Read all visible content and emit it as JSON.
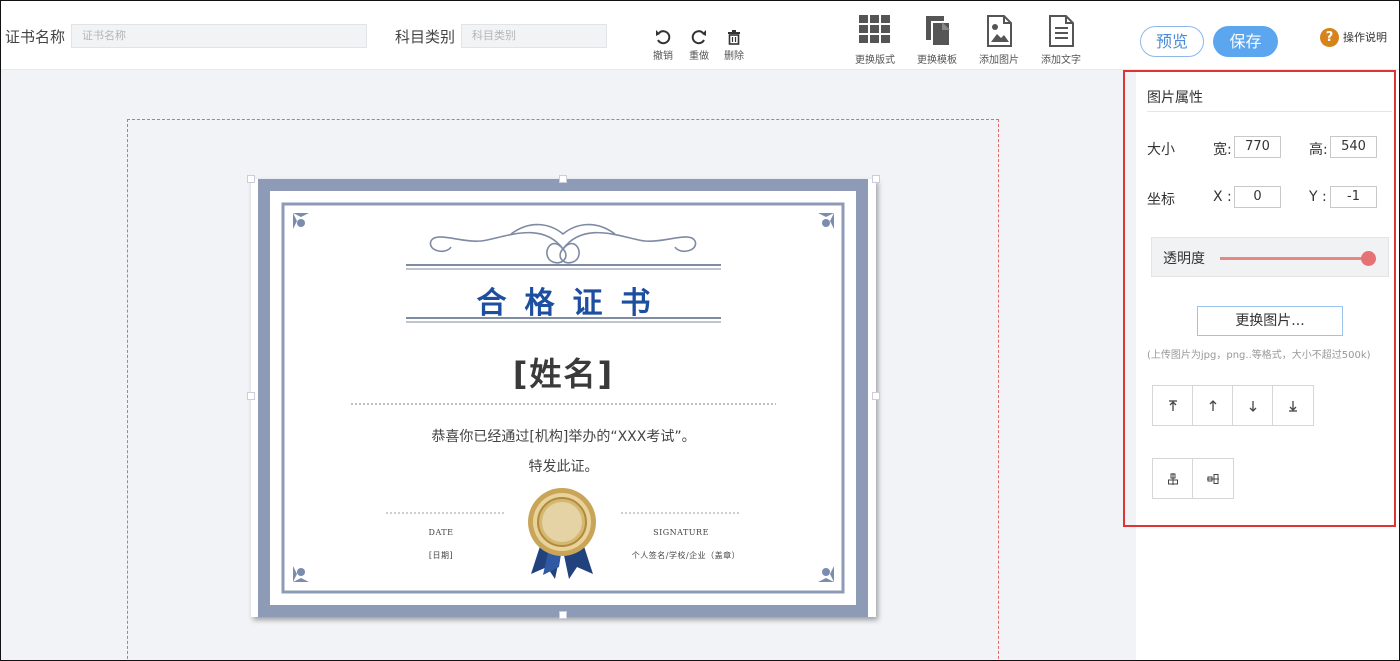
{
  "toolbar": {
    "cert_name_label": "证书名称",
    "cert_name_placeholder": "证书名称",
    "category_label": "科目类别",
    "category_placeholder": "科目类别",
    "undo_label": "撤销",
    "redo_label": "重做",
    "delete_label": "删除",
    "change_layout_label": "更换版式",
    "change_template_label": "更换模板",
    "add_image_label": "添加图片",
    "add_text_label": "添加文字",
    "preview_label": "预览",
    "save_label": "保存",
    "help_label": "操作说明"
  },
  "certificate": {
    "title": "合格证书",
    "name": "[姓名]",
    "body_line1": "恭喜你已经通过[机构]举办的“XXX考试”。",
    "body_line2": "特发此证。",
    "date_heading": "DATE",
    "date_value": "[日期]",
    "signature_heading": "SIGNATURE",
    "signature_value": "个人签名/学校/企业（盖章）"
  },
  "panel": {
    "title": "图片属性",
    "size_label": "大小",
    "width_label": "宽:",
    "width_value": "770",
    "height_label": "高:",
    "height_value": "540",
    "coord_label": "坐标",
    "x_label": "X :",
    "x_value": "0",
    "y_label": "Y :",
    "y_value": "-1",
    "opacity_label": "透明度",
    "opacity_value": 1.0,
    "replace_button": "更换图片...",
    "upload_note": "(上传图片为jpg，png..等格式，大小不超过500k)"
  },
  "colors": {
    "accent": "#5ba6ee",
    "panel_highlight": "#e03333",
    "cert_blue": "#1d4fa0",
    "cert_frame": "#8d9bb7",
    "slider": "#e57373"
  }
}
